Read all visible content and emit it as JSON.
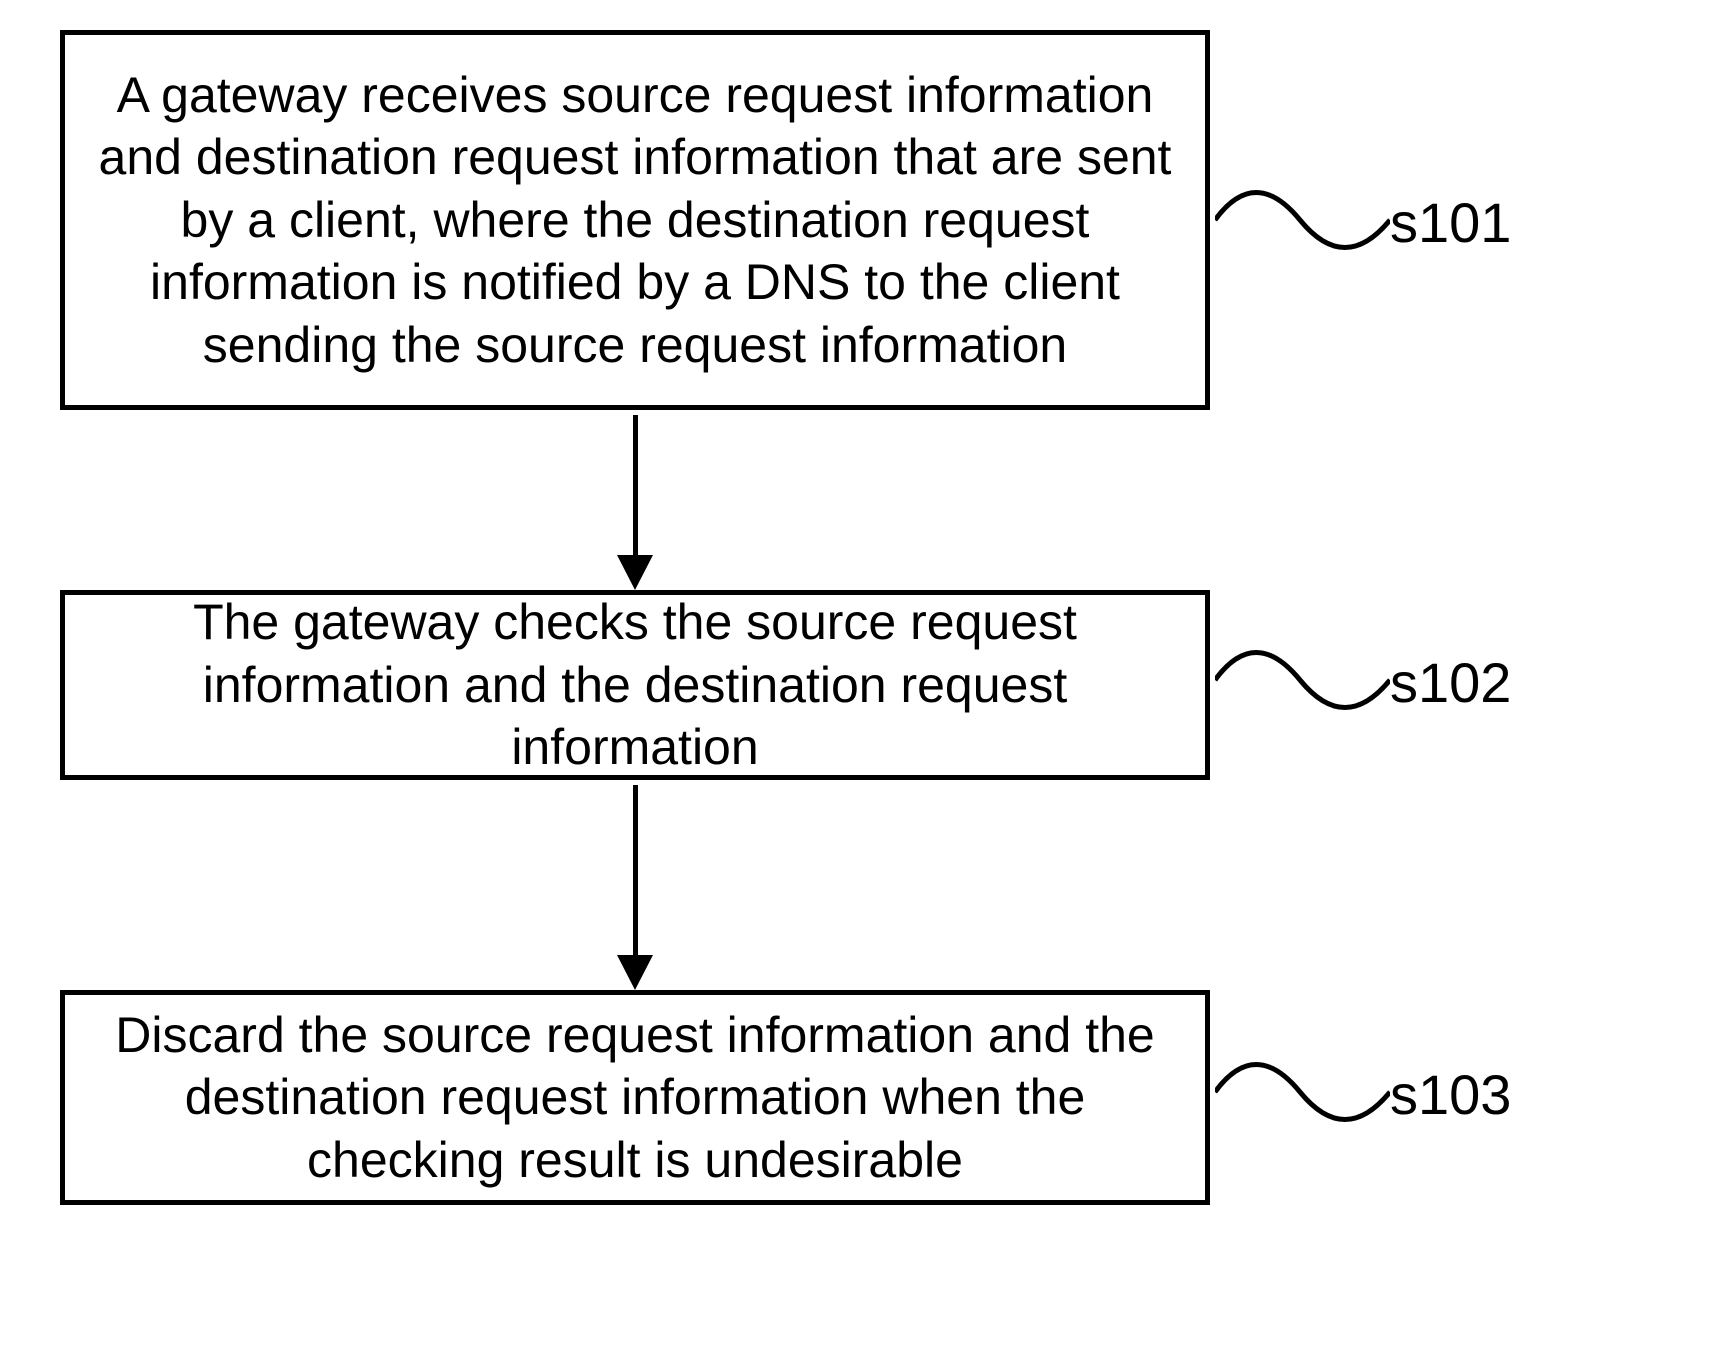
{
  "chart_data": {
    "type": "flowchart",
    "steps": [
      {
        "id": "s101",
        "text": "A gateway receives source request information and destination request information that are sent by a client, where the destination request information is notified by a DNS to the client sending the source request information"
      },
      {
        "id": "s102",
        "text": "The gateway checks the source request information and the destination request information"
      },
      {
        "id": "s103",
        "text": "Discard the source request information and the destination request information when the checking result is undesirable"
      }
    ],
    "connections": [
      {
        "from": "s101",
        "to": "s102"
      },
      {
        "from": "s102",
        "to": "s103"
      }
    ]
  }
}
